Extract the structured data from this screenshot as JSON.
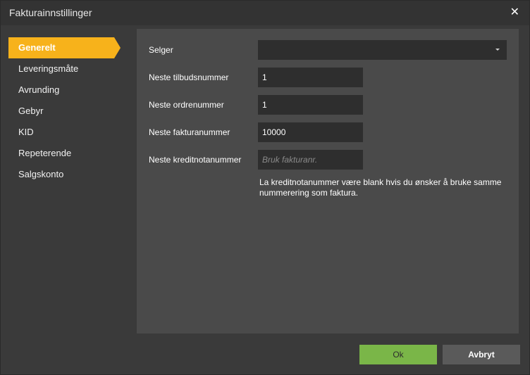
{
  "dialog": {
    "title": "Fakturainnstillinger",
    "close_icon": "close-icon"
  },
  "sidebar": {
    "items": [
      {
        "label": "Generelt",
        "active": true
      },
      {
        "label": "Leveringsmåte",
        "active": false
      },
      {
        "label": "Avrunding",
        "active": false
      },
      {
        "label": "Gebyr",
        "active": false
      },
      {
        "label": "KID",
        "active": false
      },
      {
        "label": "Repeterende",
        "active": false
      },
      {
        "label": "Salgskonto",
        "active": false
      }
    ]
  },
  "form": {
    "seller": {
      "label": "Selger",
      "value": ""
    },
    "next_quote": {
      "label": "Neste tilbudsnummer",
      "value": "1"
    },
    "next_order": {
      "label": "Neste ordrenummer",
      "value": "1"
    },
    "next_invoice": {
      "label": "Neste fakturanummer",
      "value": "10000"
    },
    "next_credit": {
      "label": "Neste kreditnotanummer",
      "value": "",
      "placeholder": "Bruk fakturanr."
    },
    "note": "La kreditnotanummer være blank hvis du ønsker å bruke samme nummerering som faktura."
  },
  "footer": {
    "ok_label": "Ok",
    "cancel_label": "Avbryt"
  },
  "colors": {
    "accent": "#f7b21b",
    "ok_button": "#7ab648",
    "background": "#3a3a3a",
    "panel": "#4a4a4a"
  }
}
